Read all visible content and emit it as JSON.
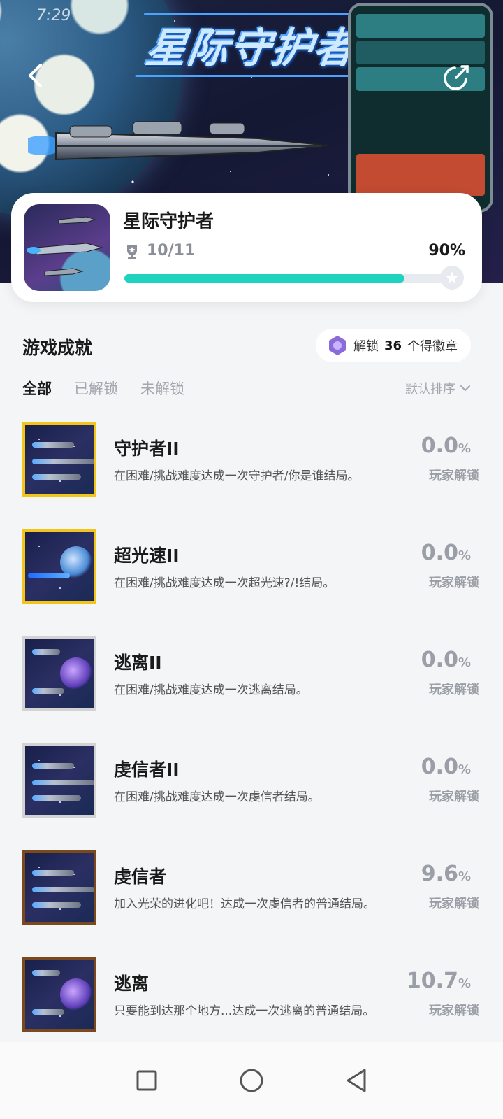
{
  "status": {
    "time": "7:29"
  },
  "hero": {
    "title": "星际守护者"
  },
  "game": {
    "name": "星际守护者",
    "achievements": "10/11",
    "percent": "90%",
    "progress": 0.9
  },
  "section": {
    "title": "游戏成就",
    "badge_prefix": "解锁",
    "badge_count": "36",
    "badge_suffix": "个得徽章"
  },
  "tabs": [
    "全部",
    "已解锁",
    "未解锁"
  ],
  "sort": {
    "label": "默认排序"
  },
  "items": [
    {
      "name": "守护者II",
      "desc": "在困难/挑战难度达成一次守护者/你是谁结局。",
      "rate": "0.0",
      "pct": "%",
      "unlock": "玩家解锁",
      "frame": "#f2c51b",
      "art": "ship"
    },
    {
      "name": "超光速II",
      "desc": "在困难/挑战难度达成一次超光速?/!结局。",
      "rate": "0.0",
      "pct": "%",
      "unlock": "玩家解锁",
      "frame": "#f2c51b",
      "art": "probe"
    },
    {
      "name": "逃离II",
      "desc": "在困难/挑战难度达成一次逃离结局。",
      "rate": "0.0",
      "pct": "%",
      "unlock": "玩家解锁",
      "frame": "#d3d3d3",
      "art": "rift"
    },
    {
      "name": "虔信者II",
      "desc": "在困难/挑战难度达成一次虔信者结局。",
      "rate": "0.0",
      "pct": "%",
      "unlock": "玩家解锁",
      "frame": "#d3d3d3",
      "art": "ship"
    },
    {
      "name": "虔信者",
      "desc": "加入光荣的进化吧！达成一次虔信者的普通结局。",
      "rate": "9.6",
      "pct": "%",
      "unlock": "玩家解锁",
      "frame": "#7a4a1e",
      "art": "ship"
    },
    {
      "name": "逃离",
      "desc": "只要能到达那个地方...达成一次逃离的普通结局。",
      "rate": "10.7",
      "pct": "%",
      "unlock": "玩家解锁",
      "frame": "#7a4a1e",
      "art": "rift"
    }
  ],
  "icons": {
    "back": "chevron-left-icon",
    "share": "share-icon",
    "trophy": "trophy-icon",
    "badge": "hexagon-badge-icon",
    "sort": "chevron-down-icon"
  },
  "colors": {
    "accent": "#1fd3bf",
    "gold": "#f2c51b",
    "bronze": "#7a4a1e"
  }
}
